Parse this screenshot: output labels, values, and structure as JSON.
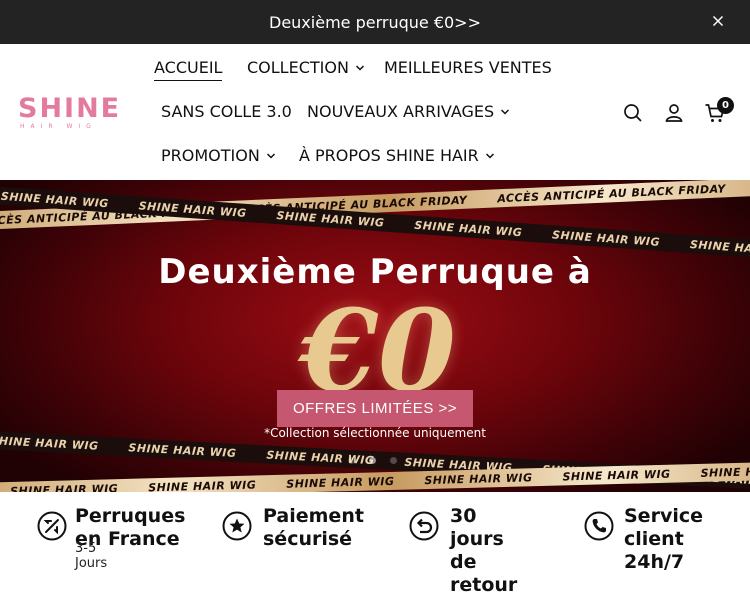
{
  "announcement": {
    "text": "Deuxième perruque €0>>"
  },
  "brand": {
    "name": "SHINE",
    "tagline": "HAIR WIG",
    "color": "#e37b9e"
  },
  "nav": {
    "items": [
      {
        "label": "ACCUEIL",
        "active": true,
        "has_dropdown": false
      },
      {
        "label": "COLLECTION",
        "has_dropdown": true
      },
      {
        "label": "MEILLEURES VENTES",
        "has_dropdown": false
      },
      {
        "label": "SANS COLLE 3.0",
        "has_dropdown": false
      },
      {
        "label": "NOUVEAUX ARRIVAGES",
        "has_dropdown": true
      },
      {
        "label": "PROMOTION",
        "has_dropdown": true
      },
      {
        "label": "À PROPOS SHINE HAIR",
        "has_dropdown": true
      }
    ]
  },
  "header_icons": {
    "search": "search-icon",
    "account": "user-icon",
    "cart": "cart-icon",
    "cart_count": "0"
  },
  "hero": {
    "stripe_gold_text": "ACCÈS ANTICIPÉ AU BLACK FRIDAY",
    "stripe_dark_text": "SHINE HAIR WIG",
    "title": "Deuxième Perruque à",
    "big_value": "€0",
    "cta_label": "OFFRES LIMITÉES >>",
    "note": "*Collection sélectionnée uniquement",
    "slides": 3,
    "active_slide": 2
  },
  "features": [
    {
      "icon": "airplane-icon",
      "title_line1": "Perruques",
      "title_line2": "en France",
      "subtitle": "3-5 Jours"
    },
    {
      "icon": "star-icon",
      "title_line1": "Paiement",
      "title_line2": "sécurisé"
    },
    {
      "icon": "return-icon",
      "title_line1": "30 jours",
      "title_line2": "de retour"
    },
    {
      "icon": "phone-icon",
      "title_line1": "Service",
      "title_line2": "client",
      "title_line3": "24h/7"
    }
  ],
  "colors": {
    "announce_bg": "#232323",
    "cta_bg": "#c65770",
    "hero_red": "#9e0c14",
    "gold": "#e8c98f"
  }
}
